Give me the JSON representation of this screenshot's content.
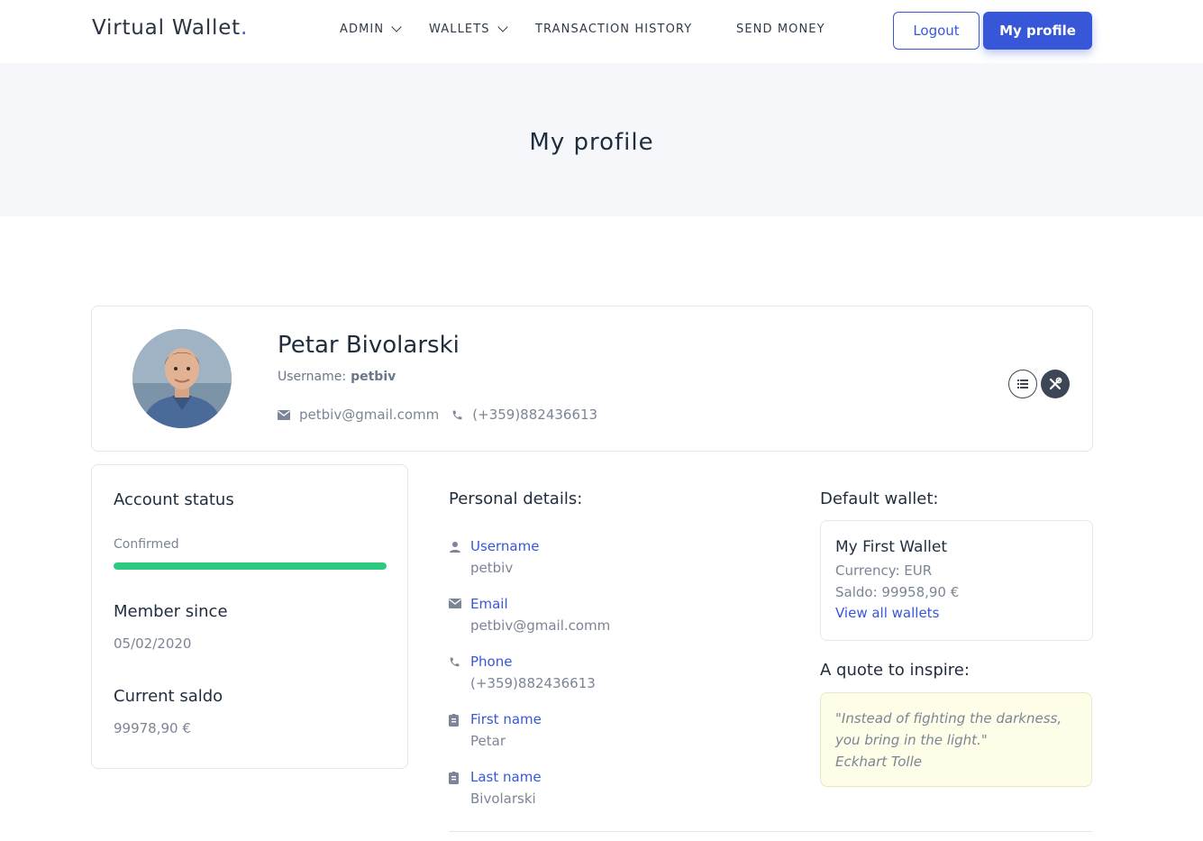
{
  "navbar": {
    "brand": "Virtual Wallet",
    "brand_dot": ".",
    "items": [
      {
        "label": "ADMIN",
        "dropdown": true
      },
      {
        "label": "WALLETS",
        "dropdown": true
      },
      {
        "label": "TRANSACTION HISTORY",
        "dropdown": false
      },
      {
        "label": "SEND MONEY",
        "dropdown": false
      }
    ],
    "logout_label": "Logout",
    "profile_label": "My profile"
  },
  "hero": {
    "title": "My profile"
  },
  "profile": {
    "name": "Petar Bivolarski",
    "username_label": "Username:",
    "username": "petbiv",
    "email": "petbiv@gmail.comm",
    "phone": "(+359)882436613"
  },
  "account": {
    "status_title": "Account status",
    "status_value": "Confirmed",
    "status_progress": 1.0,
    "member_title": "Member since",
    "member_value": "05/02/2020",
    "saldo_title": "Current saldo",
    "saldo_value": "99978,90 €"
  },
  "personal": {
    "title": "Personal details:",
    "items": [
      {
        "label": "Username",
        "value": "petbiv",
        "icon": "user-icon"
      },
      {
        "label": "Email",
        "value": "petbiv@gmail.comm",
        "icon": "mail-icon"
      },
      {
        "label": "Phone",
        "value": "(+359)882436613",
        "icon": "phone-icon"
      },
      {
        "label": "First name",
        "value": "Petar",
        "icon": "id-badge-icon"
      },
      {
        "label": "Last name",
        "value": "Bivolarski",
        "icon": "id-badge-icon"
      }
    ]
  },
  "wallet": {
    "title": "Default wallet:",
    "name": "My First Wallet",
    "currency": "Currency: EUR",
    "saldo": "Saldo: 99958,90 €",
    "link": "View all wallets"
  },
  "quote": {
    "title": "A quote to inspire:",
    "text": "\"Instead of fighting the darkness, you bring in the light.\"",
    "author": "Eckhart Tolle"
  },
  "colors": {
    "accent": "#3757d8",
    "success": "#2dc97e",
    "muted": "#7b8595"
  }
}
